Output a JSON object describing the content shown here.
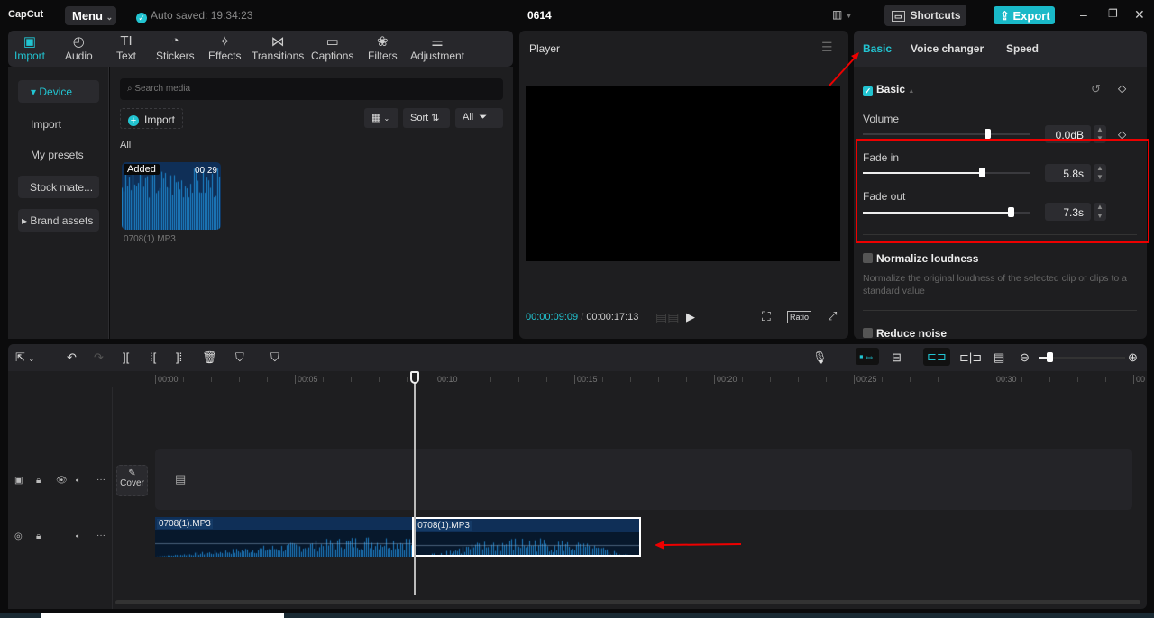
{
  "app": {
    "logo": "CapCut",
    "menu_label": "Menu",
    "autosave": "Auto saved: 19:34:23",
    "project_name": "0614",
    "shortcuts_label": "Shortcuts",
    "export_label": "Export",
    "accent": "#22c4d1"
  },
  "media_tabs": [
    {
      "label": "Import",
      "icon": "import-icon",
      "active": true
    },
    {
      "label": "Audio",
      "icon": "audio-icon"
    },
    {
      "label": "Text",
      "icon": "text-icon"
    },
    {
      "label": "Stickers",
      "icon": "sticker-icon"
    },
    {
      "label": "Effects",
      "icon": "effects-icon"
    },
    {
      "label": "Transitions",
      "icon": "transitions-icon"
    },
    {
      "label": "Captions",
      "icon": "captions-icon"
    },
    {
      "label": "Filters",
      "icon": "filters-icon"
    },
    {
      "label": "Adjustment",
      "icon": "adjustment-icon"
    }
  ],
  "sidebar": {
    "items": [
      {
        "label": "▾ Device",
        "active": true
      },
      {
        "label": "Import"
      },
      {
        "label": "My presets"
      },
      {
        "label": "Stock mate..."
      },
      {
        "label": "▸ Brand assets"
      }
    ]
  },
  "media": {
    "search_placeholder": "Search media",
    "import_label": "Import",
    "sort_label": "Sort",
    "filter_label": "All",
    "section_label": "All",
    "items": [
      {
        "name": "0708(1).MP3",
        "badge": "Added",
        "duration": "00:29"
      }
    ]
  },
  "player": {
    "title": "Player",
    "current_time": "00:00:09:09",
    "total_time": "00:00:17:13",
    "ratio_label": "Ratio"
  },
  "properties": {
    "tabs": [
      {
        "label": "Basic",
        "active": true
      },
      {
        "label": "Voice changer"
      },
      {
        "label": "Speed"
      }
    ],
    "section_title": "Basic",
    "volume": {
      "label": "Volume",
      "value": "0.0dB",
      "level": 0.74
    },
    "fade_in": {
      "label": "Fade in",
      "value": "5.8s",
      "level": 0.71
    },
    "fade_out": {
      "label": "Fade out",
      "value": "7.3s",
      "level": 0.88
    },
    "normalize": {
      "label": "Normalize loudness",
      "description": "Normalize the original loudness of the selected clip or clips to a standard value",
      "checked": false
    },
    "reduce_noise": {
      "label": "Reduce noise",
      "checked": false
    }
  },
  "timeline": {
    "ruler_labels": [
      "00:00",
      "00:05",
      "00:10",
      "00:15",
      "00:20",
      "00:25",
      "00:30",
      "00"
    ],
    "cover_label": "Cover",
    "playhead_seconds": 9.3,
    "clips": [
      {
        "name": "0708(1).MP3",
        "start": 0,
        "end": 9.2,
        "selected": false
      },
      {
        "name": "0708(1).MP3",
        "start": 9.2,
        "end": 17.4,
        "selected": true
      }
    ]
  }
}
